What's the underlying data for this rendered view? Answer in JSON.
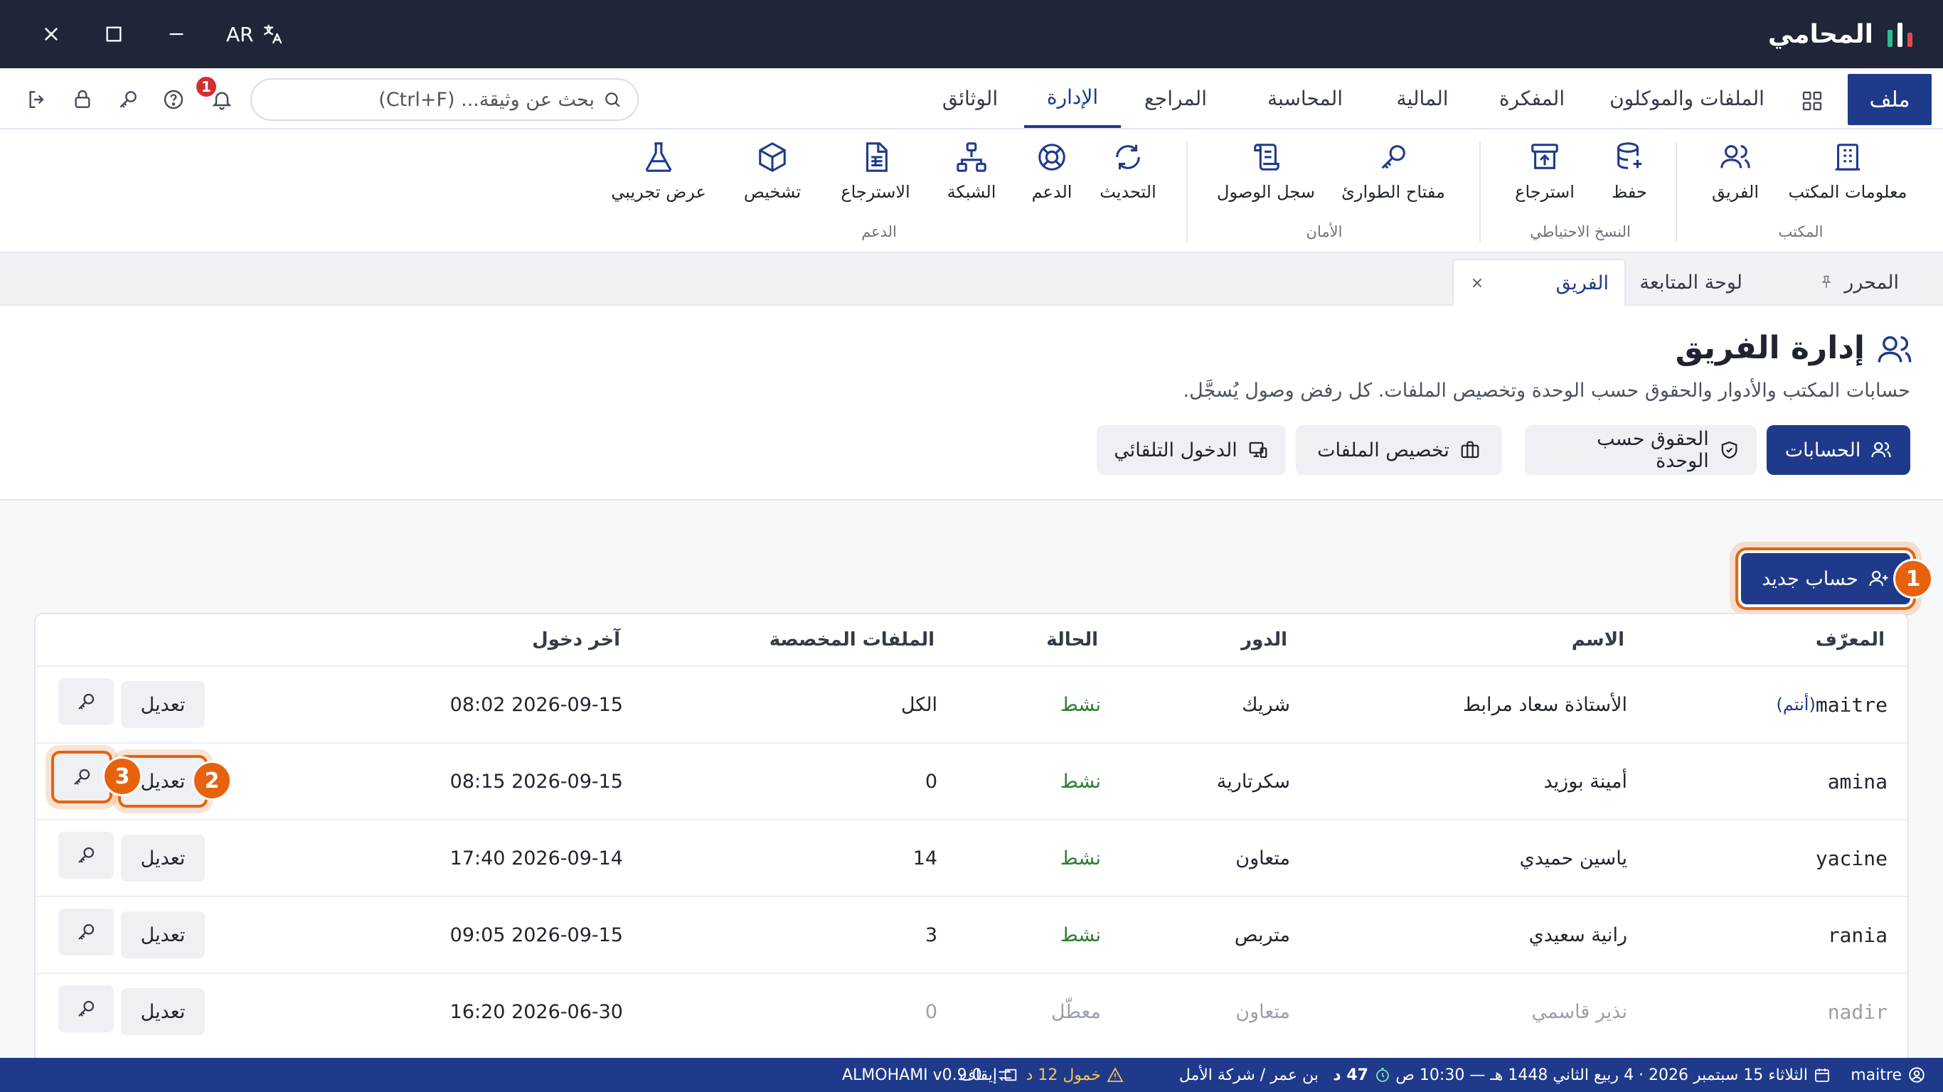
{
  "app": {
    "name": "المحامي",
    "lang_code": "AR",
    "accent_color": "#1f3a8a",
    "highlight_color": "#e8620d"
  },
  "menubar": {
    "file": "ملف",
    "tabs": [
      "الملفات والموكلون",
      "المفكرة",
      "المالية",
      "المحاسبة",
      "المراجع",
      "الإدارة",
      "الوثائق"
    ],
    "active_tab": "الإدارة",
    "search_placeholder": "بحث عن وثيقة... (Ctrl+F)",
    "notification_count": "1"
  },
  "ribbon": {
    "groups": [
      {
        "label": "المكتب",
        "items": [
          "معلومات المكتب",
          "الفريق"
        ]
      },
      {
        "label": "النسخ الاحتياطي",
        "items": [
          "حفظ",
          "استرجاع"
        ]
      },
      {
        "label": "الأمان",
        "items": [
          "مفتاح الطوارئ",
          "سجل الوصول"
        ]
      },
      {
        "label": "الدعم",
        "items": [
          "التحديث",
          "الدعم",
          "الشبكة",
          "الاسترجاع",
          "تشخيص",
          "عرض تجريبي"
        ]
      }
    ]
  },
  "doctabs": [
    "المحرر",
    "لوحة المتابعة",
    "الفريق"
  ],
  "page": {
    "title": "إدارة الفريق",
    "subtitle": "حسابات المكتب والأدوار والحقوق حسب الوحدة وتخصيص الملفات. كل رفض وصول يُسجَّل.",
    "subtabs": [
      "الحسابات",
      "الحقوق حسب الوحدة",
      "تخصيص الملفات",
      "الدخول التلقائي"
    ],
    "new_account": "حساب جديد"
  },
  "callouts": [
    "1",
    "2",
    "3"
  ],
  "table": {
    "headers": [
      "المعرّف",
      "الاسم",
      "الدور",
      "الحالة",
      "الملفات المخصصة",
      "آخر دخول"
    ],
    "edit_label": "تعديل",
    "you_label": "(أنتم)",
    "rows": [
      {
        "id": "maitre",
        "name": "الأستاذة سعاد مرابط",
        "role": "شريك",
        "status": "نشط",
        "files": "الكل",
        "last": "2026-09-15 08:02",
        "active": true
      },
      {
        "id": "amina",
        "name": "أمينة بوزيد",
        "role": "سكرتارية",
        "status": "نشط",
        "files": "0",
        "last": "2026-09-15 08:15",
        "active": true
      },
      {
        "id": "yacine",
        "name": "ياسين حميدي",
        "role": "متعاون",
        "status": "نشط",
        "files": "14",
        "last": "2026-09-14 17:40",
        "active": true
      },
      {
        "id": "rania",
        "name": "رانية سعيدي",
        "role": "متربص",
        "status": "نشط",
        "files": "3",
        "last": "2026-09-15 09:05",
        "active": true
      },
      {
        "id": "nadir",
        "name": "نذير قاسمي",
        "role": "متعاون",
        "status": "معطّل",
        "files": "0",
        "last": "2026-06-30 16:20",
        "active": false
      }
    ]
  },
  "statusbar": {
    "user": "maitre",
    "date": "الثلاثاء 15 سبتمبر 2026 · 4 ربيع الثاني 1448 هـ — 10:30 ص",
    "timer": "47 د",
    "client": "بن عمر / شركة الأمل",
    "idle": "خمول 12 د",
    "pause": "إيقاف",
    "version": "ALMOHAMI v0.9.0"
  }
}
